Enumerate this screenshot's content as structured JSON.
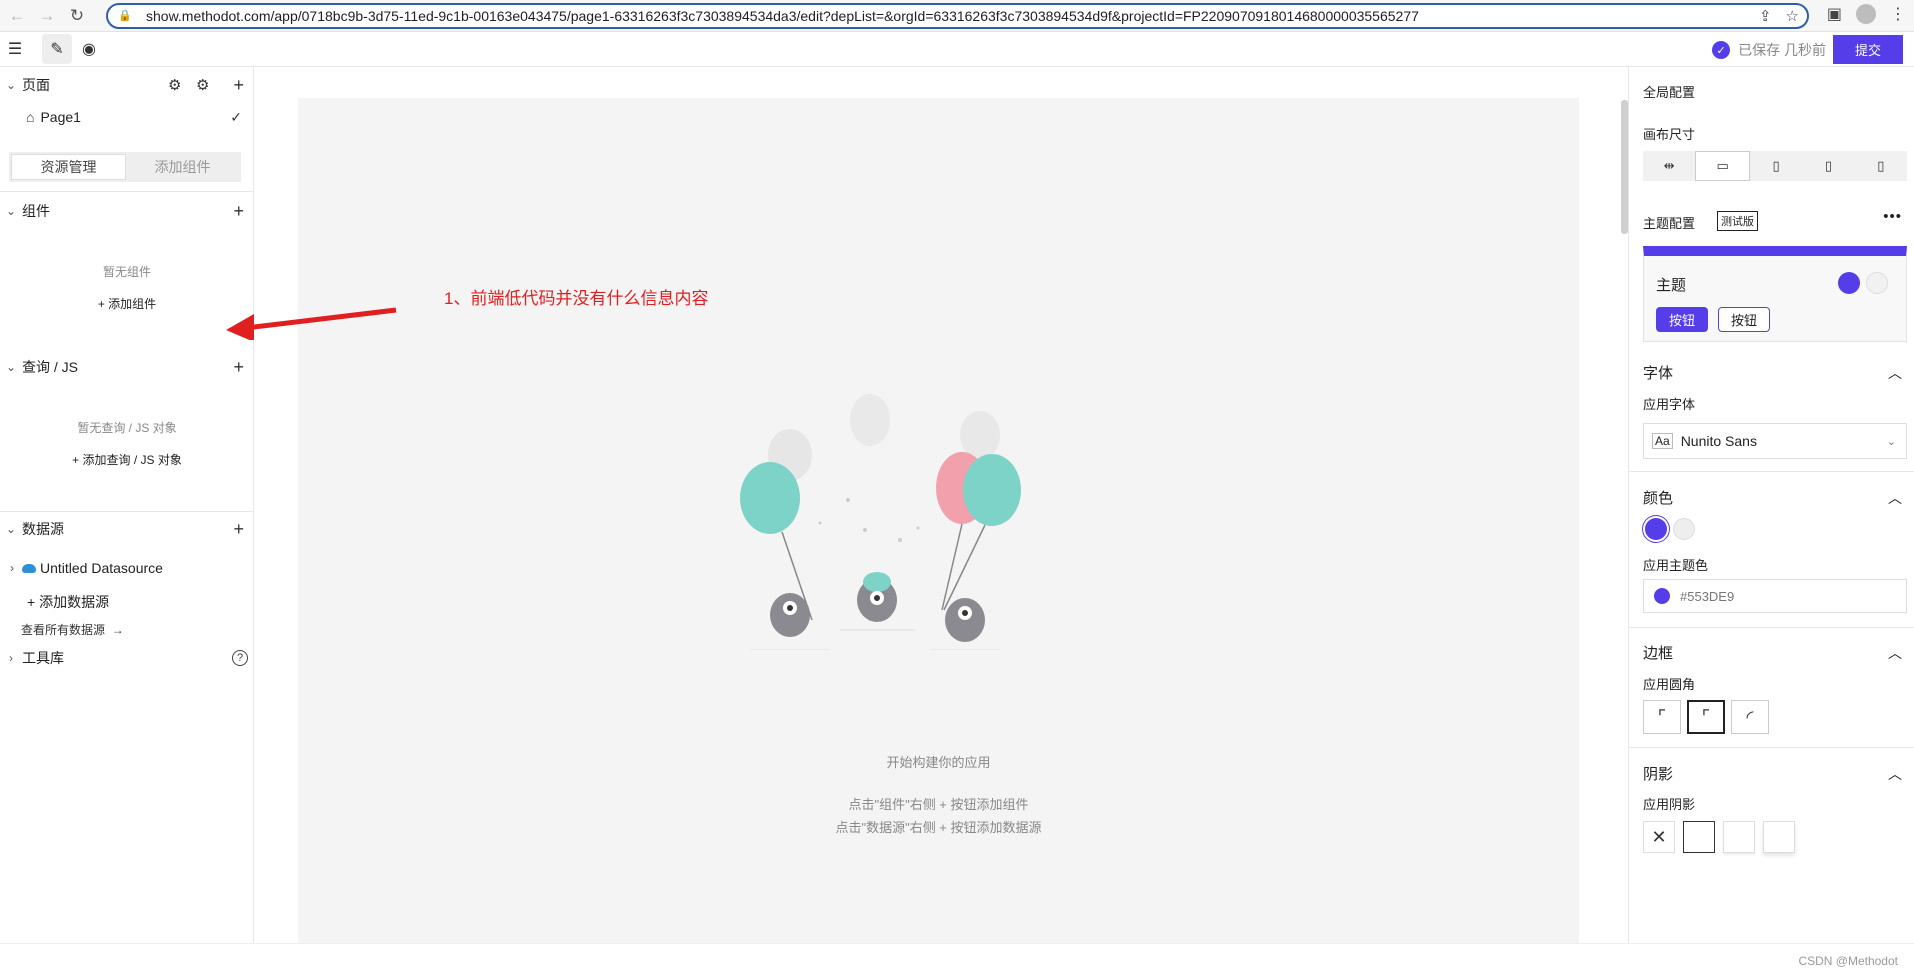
{
  "browser": {
    "url": "show.methodot.com/app/0718bc9b-3d75-11ed-9c1b-00163e043475/page1-63316263f3c7303894534da3/edit?depList=&orgId=63316263f3c7303894534d9f&projectId=FP22090709180146800000355652​77"
  },
  "toolbar": {
    "saved_text": "已保存 几秒前",
    "submit_label": "提交"
  },
  "left": {
    "pages_title": "页面",
    "page_name": "Page1",
    "tabs": [
      "资源管理",
      "添加组件"
    ],
    "components_title": "组件",
    "components_empty": "暂无组件",
    "components_add": "+ 添加组件",
    "queries_title": "查询 / JS",
    "queries_empty": "暂无查询 / JS 对象",
    "queries_add": "+ 添加查询 / JS 对象",
    "datasource_title": "数据源",
    "datasource_item": "Untitled Datasource",
    "datasource_add": "添加数据源",
    "datasource_view_all": "查看所有数据源",
    "library_title": "工具库"
  },
  "canvas": {
    "annotation": "1、前端低代码并没有什么信息内容",
    "empty_title": "开始构建你的应用",
    "hint1": "点击\"组件\"右侧 + 按钮添加组件",
    "hint2": "点击\"数据源\"右侧 + 按钮添加数据源"
  },
  "right": {
    "global_config": "全局配置",
    "canvas_size": "画布尺寸",
    "theme_config": "主题配置",
    "beta": "测试版",
    "theme": "主题",
    "btn_primary": "按钮",
    "btn_secondary": "按钮",
    "font_section": "字体",
    "app_font": "应用字体",
    "font_value": "Nunito Sans",
    "color_section": "颜色",
    "app_theme_color": "应用主题色",
    "theme_color_value": "#553DE9",
    "border_section": "边框",
    "app_radius": "应用圆角",
    "shadow_section": "阴影",
    "app_shadow": "应用阴影"
  },
  "colors": {
    "accent": "#553DE9",
    "annotation": "#e02020"
  },
  "watermark": "CSDN @Methodot"
}
